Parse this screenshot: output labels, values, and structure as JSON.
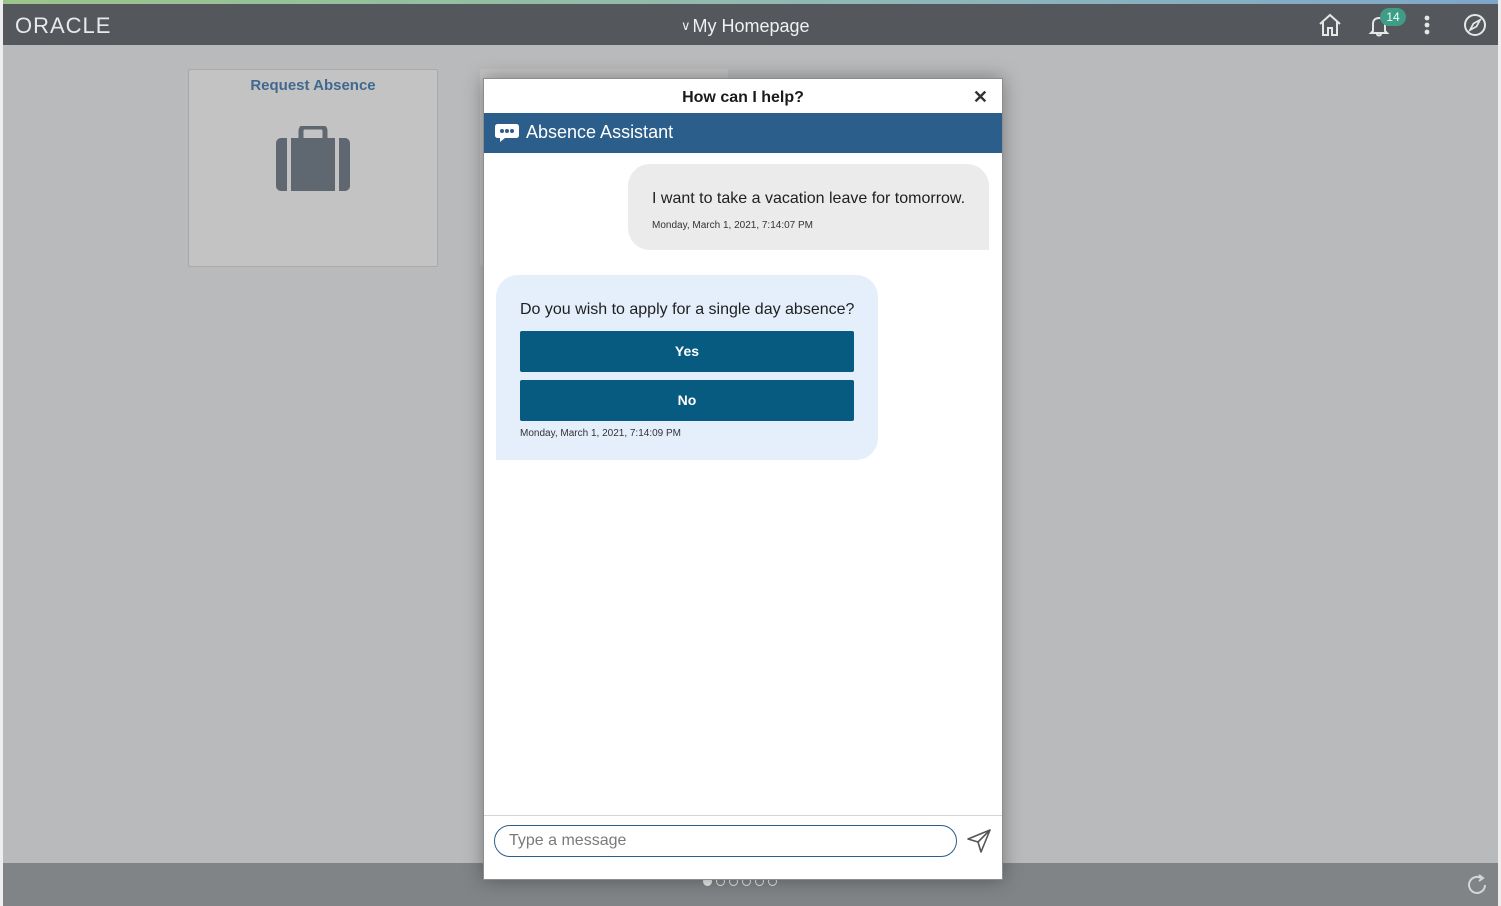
{
  "header": {
    "logo": "ORACLE",
    "page_title": "My Homepage",
    "notification_count": "14",
    "icons": [
      "home-icon",
      "bell-icon",
      "more-vertical-icon",
      "navigator-compass-icon"
    ]
  },
  "tile": {
    "title": "Request Absence",
    "icon": "briefcase-icon"
  },
  "chat": {
    "title": "How can I help?",
    "assistant_name": "Absence Assistant",
    "user_message": "I want to take a vacation leave for tomorrow.",
    "user_timestamp": "Monday, March 1, 2021, 7:14:07 PM",
    "bot_message": "Do you wish to apply for a single day absence?",
    "options": [
      "Yes",
      "No"
    ],
    "bot_timestamp": "Monday, March 1, 2021, 7:14:09 PM",
    "input_placeholder": "Type a message"
  },
  "colors": {
    "header": "#54575c",
    "assistant_bar": "#2b5e8a",
    "button": "#075b80",
    "bot_bubble": "#e4effb",
    "user_bubble": "#ebebeb"
  },
  "pagination": {
    "total": 6,
    "active": 1
  }
}
